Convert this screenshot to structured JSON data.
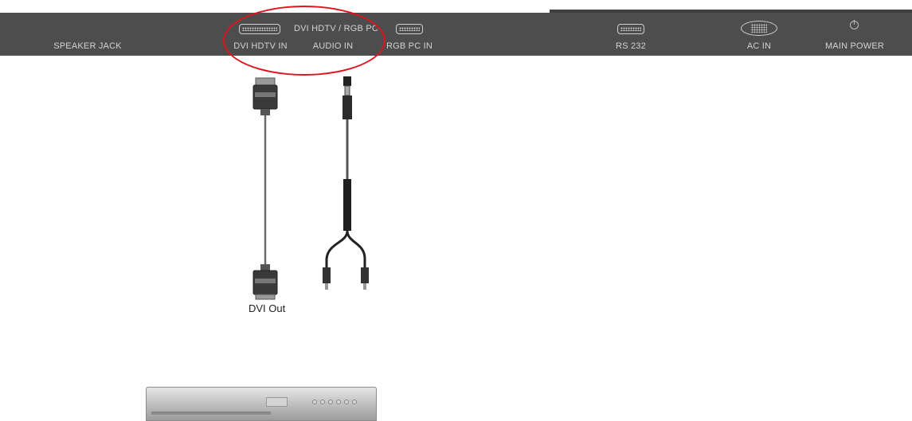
{
  "panel": {
    "speaker_jack": "SPEAKER JACK",
    "dvi_hdtv_in": "DVI HDTV IN",
    "audio_in_line1": "DVI HDTV / RGB PC",
    "audio_in_line2": "AUDIO IN",
    "rgb_pc_in": "RGB PC IN",
    "rs232": "RS 232",
    "ac_in": "AC IN",
    "main_power": "MAIN POWER"
  },
  "cable": {
    "dvi_out_label": "DVI Out"
  },
  "colors": {
    "panel_bg": "#4d4d4d",
    "panel_text": "#d2d2d2",
    "highlight": "#e0141e"
  },
  "icons": {
    "dvi_port": "dvi-port-icon",
    "vga_port": "vga-port-icon",
    "serial_port": "serial-port-icon",
    "ac_socket": "ac-socket-icon",
    "power": "power-icon"
  }
}
